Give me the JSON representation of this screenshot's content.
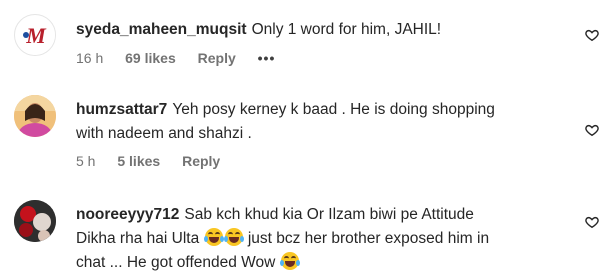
{
  "comments": [
    {
      "username": "syeda_maheen_muqsit",
      "text": "Only 1 word for him, JAHIL!",
      "time": "16 h",
      "likes": "69 likes",
      "reply": "Reply",
      "more": "•••"
    },
    {
      "username": "humzsattar7",
      "text_line1": "Yeh posy kerney k baad . He is doing shopping",
      "text_line2": "with nadeem and shahzi .",
      "time": "5 h",
      "likes": "5 likes",
      "reply": "Reply"
    },
    {
      "username": "nooreeyyy712",
      "text_line1": "Sab kch khud kia Or Ilzam biwi pe Attitude",
      "text_line2a": "Dikha rha hai Ulta",
      "text_line2b": "just bcz her brother exposed him in",
      "text_line3": "chat ... He got offended Wow",
      "emoji": "face-with-tears-of-joy"
    }
  ],
  "colors": {
    "text": "#262626",
    "meta": "#737373",
    "background": "#ffffff"
  }
}
